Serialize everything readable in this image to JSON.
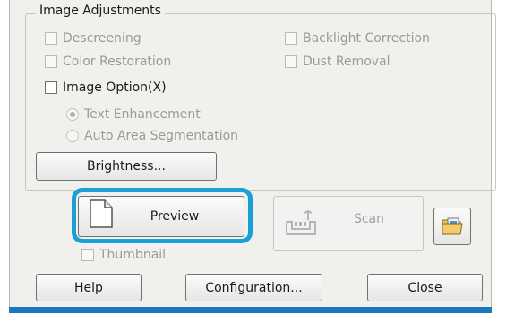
{
  "group": {
    "title": "Image Adjustments"
  },
  "options": {
    "descreening": "Descreening",
    "backlight_correction": "Backlight Correction",
    "color_restoration": "Color Restoration",
    "dust_removal": "Dust Removal",
    "image_option": "Image Option(X)",
    "text_enhancement": "Text Enhancement",
    "auto_area_segmentation": "Auto Area Segmentation"
  },
  "buttons": {
    "brightness": "Brightness...",
    "preview": "Preview",
    "scan": "Scan",
    "help": "Help",
    "configuration": "Configuration...",
    "close": "Close"
  },
  "thumbnail": "Thumbnail",
  "icons": {
    "preview": "document-icon",
    "scan": "scanner-icon",
    "folder": "file-save-settings-icon"
  },
  "colors": {
    "highlight": "#1aa0d6",
    "bottom_strip": "#1c78bd"
  }
}
